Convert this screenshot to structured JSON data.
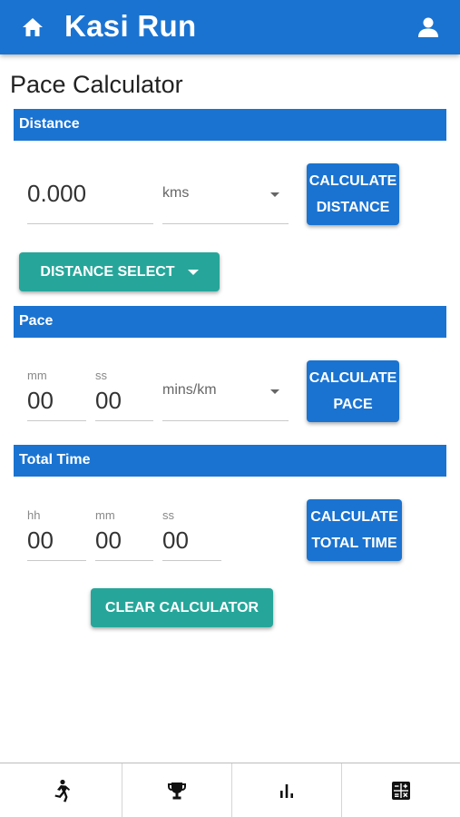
{
  "app": {
    "title": "Kasi Run",
    "accent": "#1a73d1",
    "secondary": "#26a69a"
  },
  "icons": {
    "home": "home-icon",
    "user": "user-icon"
  },
  "page": {
    "title": "Pace Calculator"
  },
  "distance": {
    "header": "Distance",
    "value": "0.000",
    "unit": "kms",
    "calc_line1": "CALCULATE",
    "calc_line2": "DISTANCE",
    "select_label": "DISTANCE SELECT"
  },
  "pace": {
    "header": "Pace",
    "mm_label": "mm",
    "mm_value": "00",
    "ss_label": "ss",
    "ss_value": "00",
    "unit": "mins/km",
    "calc_line1": "CALCULATE",
    "calc_line2": "PACE"
  },
  "total_time": {
    "header": "Total Time",
    "hh_label": "hh",
    "hh_value": "00",
    "mm_label": "mm",
    "mm_value": "00",
    "ss_label": "ss",
    "ss_value": "00",
    "calc_line1": "CALCULATE",
    "calc_line2": "TOTAL TIME"
  },
  "clear_label": "CLEAR CALCULATOR",
  "bottom_nav": [
    {
      "icon": "runner-icon"
    },
    {
      "icon": "trophy-icon"
    },
    {
      "icon": "bar-chart-icon"
    },
    {
      "icon": "calculator-icon"
    }
  ]
}
